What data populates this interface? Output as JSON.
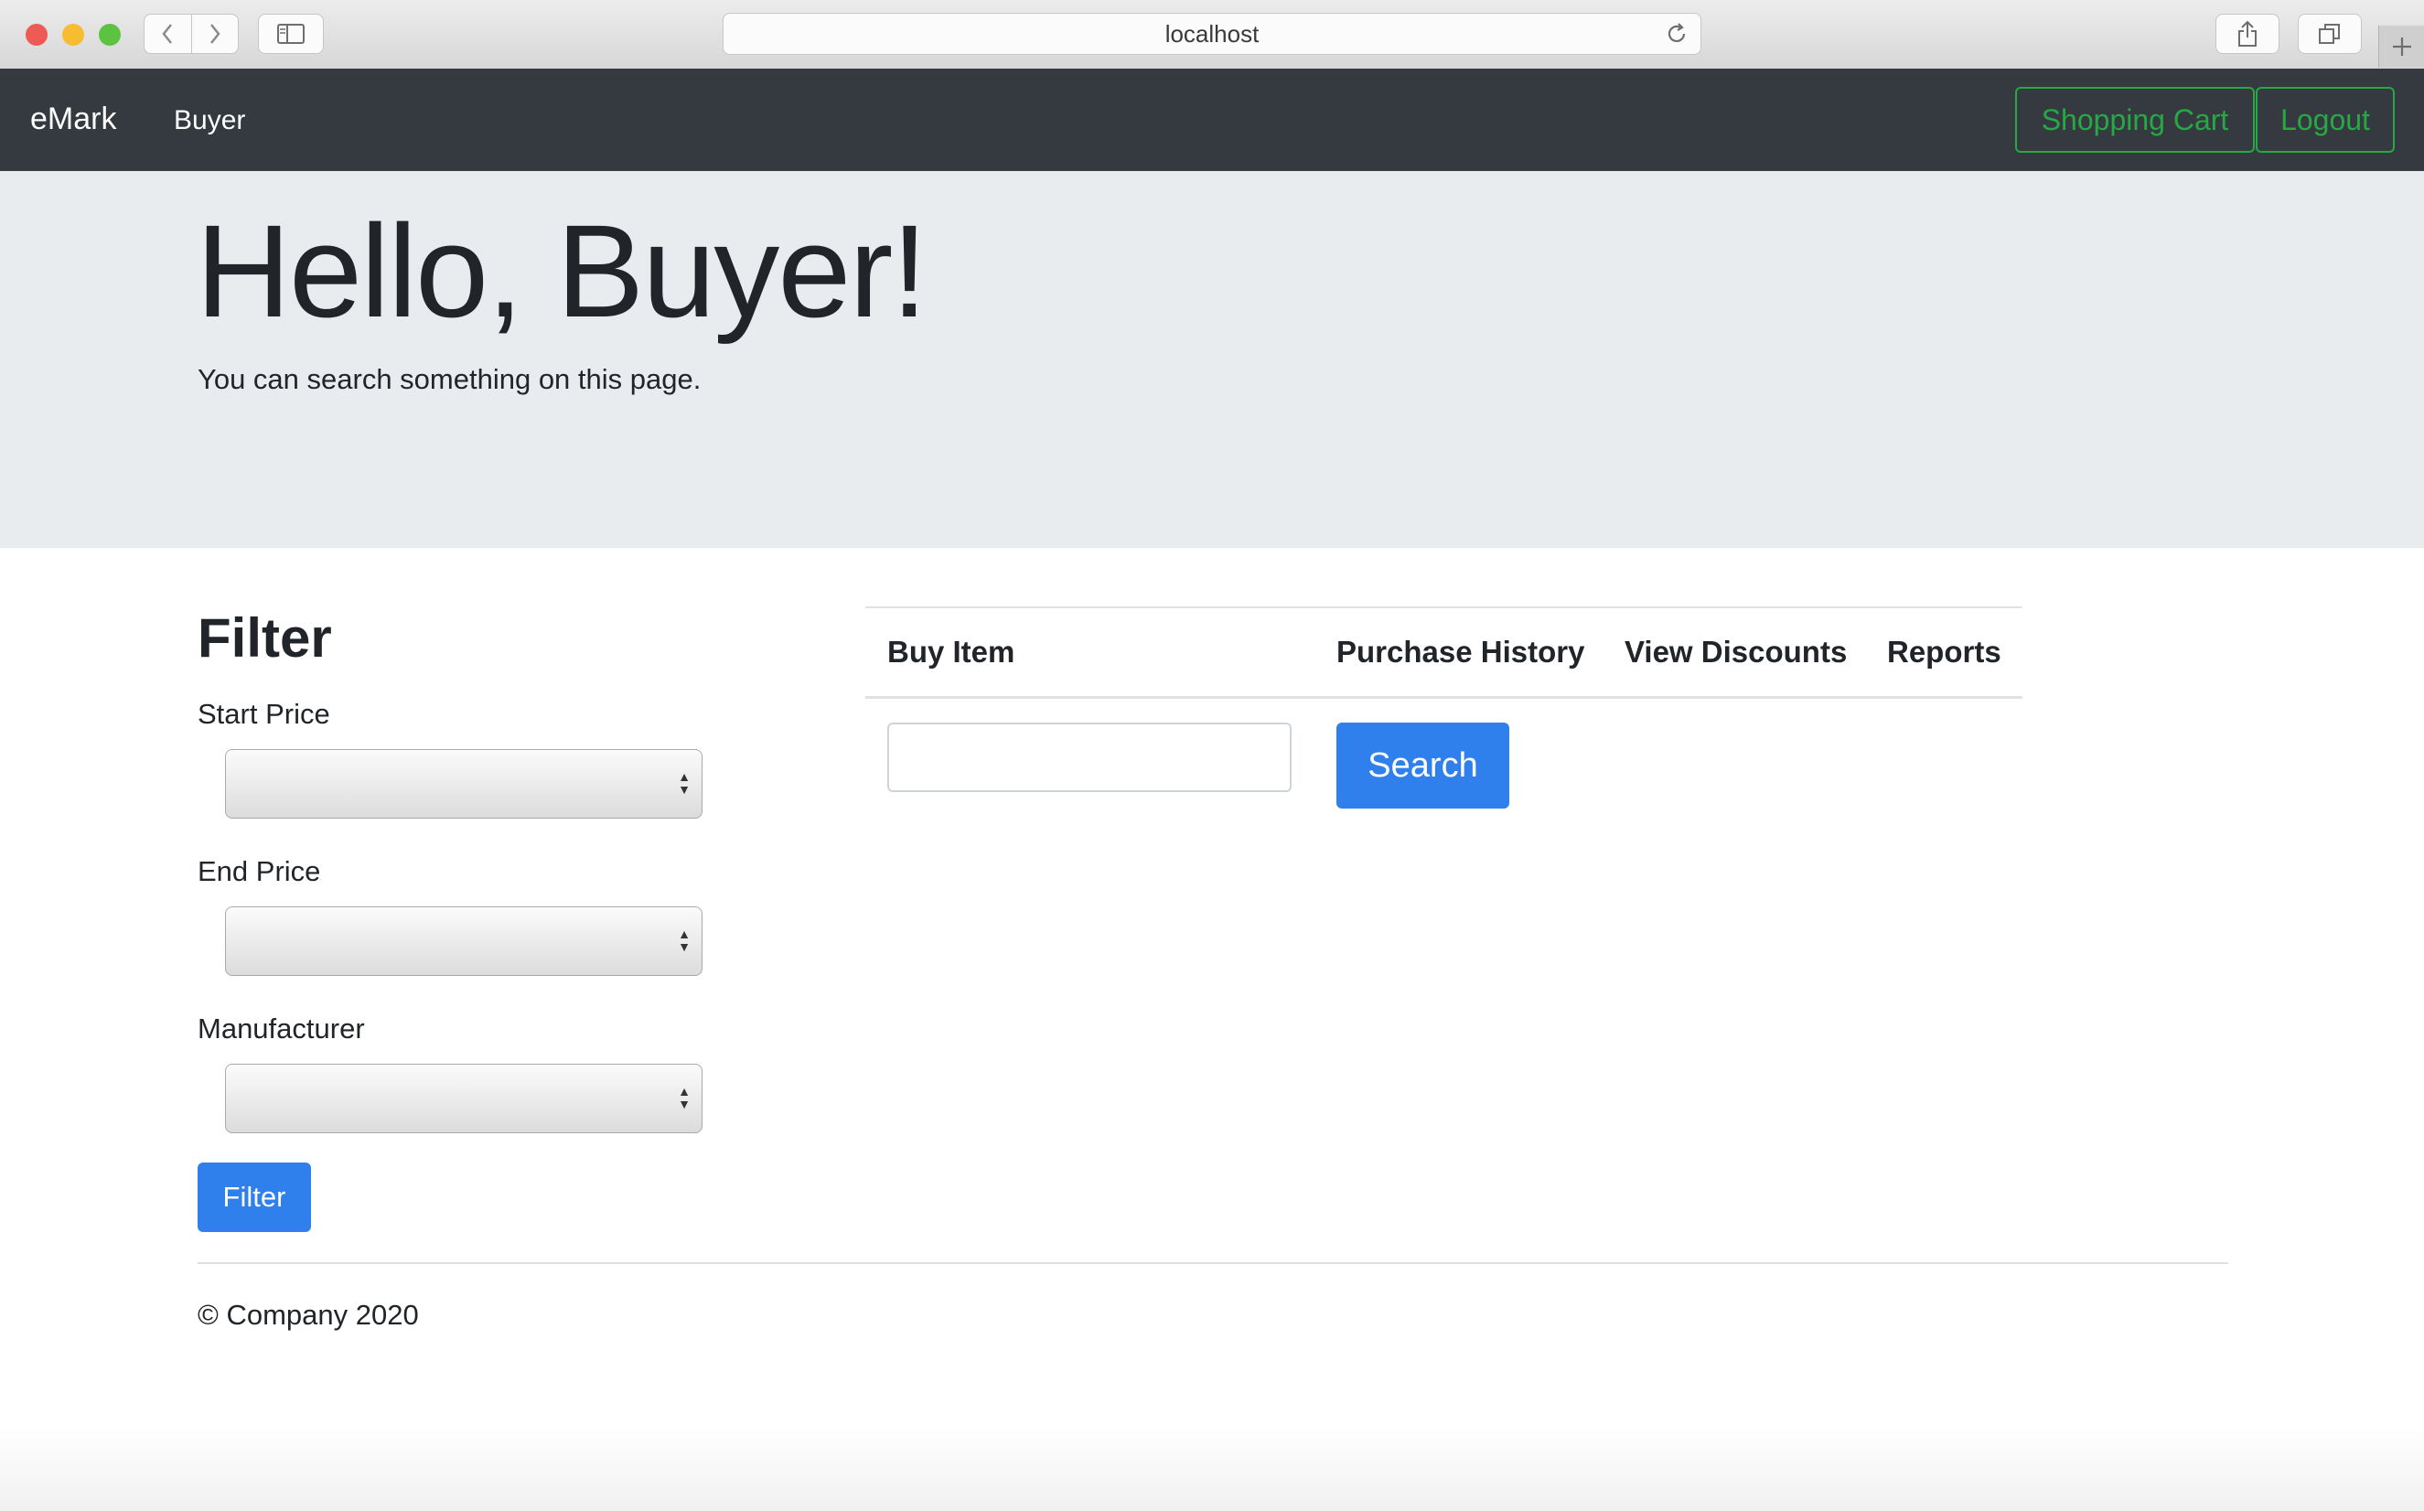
{
  "browser": {
    "url": "localhost"
  },
  "navbar": {
    "brand": "eMark",
    "link": "Buyer",
    "cart_label": "Shopping Cart",
    "logout_label": "Logout",
    "accent_color": "#28a745"
  },
  "jumbotron": {
    "title": "Hello, Buyer!",
    "lead": "You can search something on this page."
  },
  "filter": {
    "heading": "Filter",
    "start_price_label": "Start Price",
    "end_price_label": "End Price",
    "manufacturer_label": "Manufacturer",
    "button_label": "Filter"
  },
  "tabs": [
    {
      "label": "Buy Item"
    },
    {
      "label": "Purchase History"
    },
    {
      "label": "View Discounts"
    },
    {
      "label": "Reports"
    }
  ],
  "search": {
    "value": "",
    "button_label": "Search"
  },
  "footer": {
    "text": "© Company 2020"
  },
  "colors": {
    "primary": "#2f80ed",
    "navbar": "#343a40",
    "jumbotron": "#e9ecef"
  }
}
